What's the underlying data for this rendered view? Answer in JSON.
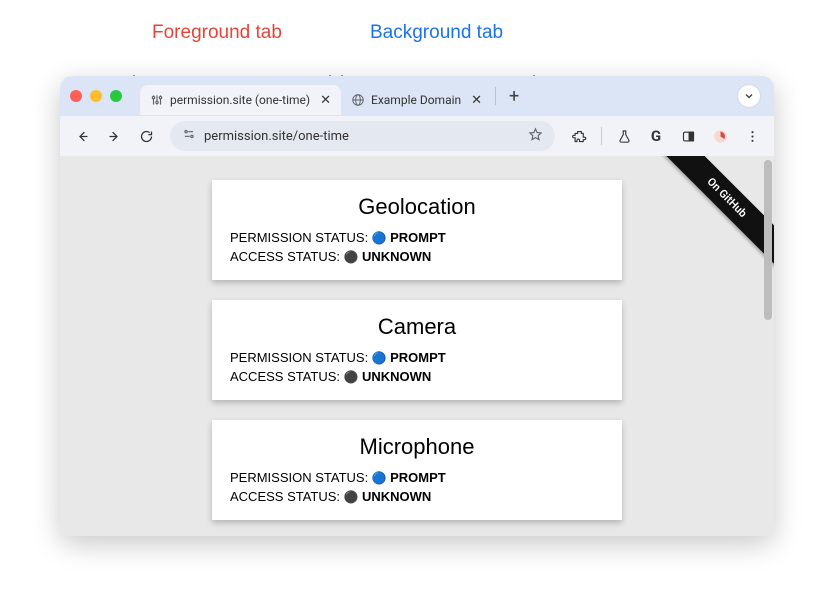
{
  "annotations": {
    "foreground_label": "Foreground tab",
    "background_label": "Background tab"
  },
  "tabs": {
    "active": {
      "title": "permission.site (one-time)"
    },
    "inactive": {
      "title": "Example Domain"
    }
  },
  "toolbar": {
    "url": "permission.site/one-time"
  },
  "ribbon": {
    "text": "On GitHub"
  },
  "cards": [
    {
      "title": "Geolocation",
      "perm_label": "PERMISSION STATUS: ",
      "perm_value": "PROMPT",
      "access_label": "ACCESS STATUS: ",
      "access_value": "UNKNOWN"
    },
    {
      "title": "Camera",
      "perm_label": "PERMISSION STATUS: ",
      "perm_value": "PROMPT",
      "access_label": "ACCESS STATUS: ",
      "access_value": "UNKNOWN"
    },
    {
      "title": "Microphone",
      "perm_label": "PERMISSION STATUS: ",
      "perm_value": "PROMPT",
      "access_label": "ACCESS STATUS: ",
      "access_value": "UNKNOWN"
    }
  ]
}
